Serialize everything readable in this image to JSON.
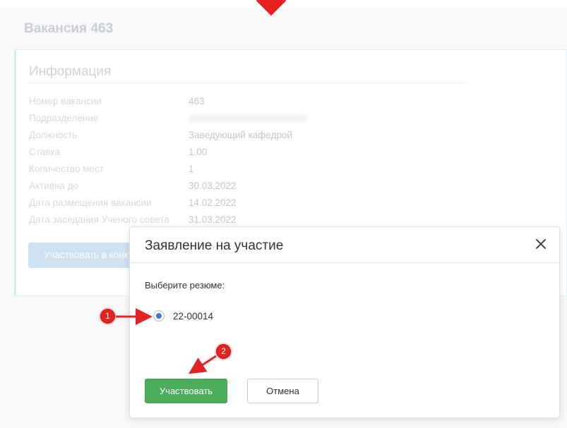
{
  "page": {
    "title": "Вакансия 463"
  },
  "info": {
    "title": "Информация",
    "rows": [
      {
        "label": "Номер вакансии",
        "value": "463"
      },
      {
        "label": "Подразделение",
        "value": ""
      },
      {
        "label": "Должность",
        "value": "Заведующий кафедрой"
      },
      {
        "label": "Ставка",
        "value": "1.00"
      },
      {
        "label": "Количество мест",
        "value": "1"
      },
      {
        "label": "Активна до",
        "value": "30.03.2022"
      },
      {
        "label": "Дата размещения вакансии",
        "value": "14.02.2022"
      },
      {
        "label": "Дата заседания Ученого совета",
        "value": "31.03.2022"
      }
    ],
    "apply_button": "Участвовать в конкурсе"
  },
  "modal": {
    "title": "Заявление на участие",
    "close_icon": "close-icon",
    "select_label": "Выберите резюме:",
    "resume_option": "22-00014",
    "submit_button": "Участвовать",
    "cancel_button": "Отмена"
  },
  "annotations": {
    "badge_1": "1",
    "badge_2": "2",
    "color": "#e22424"
  },
  "colors": {
    "submit_green": "#4cae5c",
    "radio_blue": "#3a7bd5",
    "marker_red": "#e8201e"
  }
}
